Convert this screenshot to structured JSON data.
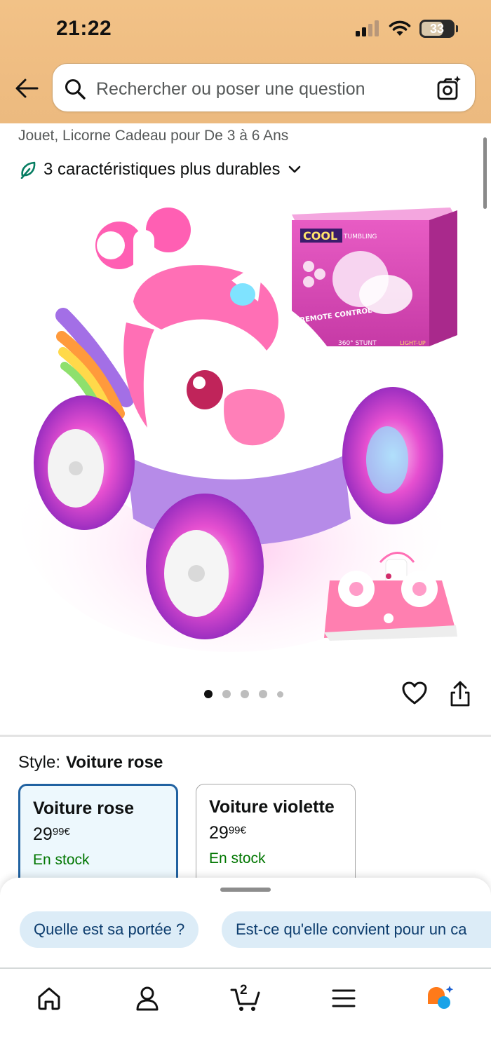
{
  "status_bar": {
    "time": "21:22",
    "battery": "33"
  },
  "search": {
    "placeholder": "Rechercher ou poser une question"
  },
  "product": {
    "title_fragment": "Jouet, Licorne Cadeau pour De 3 à 6 Ans",
    "sustainability_label": "3 caractéristiques plus durables"
  },
  "product_image_text": {
    "box_brand": "COOL",
    "box_brand_sub": "TUMBLING",
    "box_label_remote": "REMOTE CONTROL",
    "box_label_stunt": "360° STUNT",
    "box_label_light": "LIGHT-UP"
  },
  "carousel": {
    "total": 5,
    "active_index": 0
  },
  "style": {
    "label": "Style:",
    "selected_value": "Voiture rose",
    "options": [
      {
        "name": "Voiture rose",
        "price_whole": "29",
        "price_fraction": "99",
        "currency": "€",
        "stock": "En stock"
      },
      {
        "name": "Voiture violette",
        "price_whole": "29",
        "price_fraction": "99",
        "currency": "€",
        "stock": "En stock"
      }
    ]
  },
  "questions": {
    "chips": [
      "Quelle est sa portée ?",
      "Est-ce qu'elle convient pour un ca"
    ]
  },
  "bottom_nav": {
    "items": [
      "home-icon",
      "account-icon",
      "cart-icon",
      "menu-icon",
      "rufus-icon"
    ],
    "cart_count": "2"
  },
  "colors": {
    "header_bg": "#efbd82",
    "selected_border": "#2162a1",
    "stock_green": "#007600",
    "chip_bg": "#dcecf7"
  }
}
